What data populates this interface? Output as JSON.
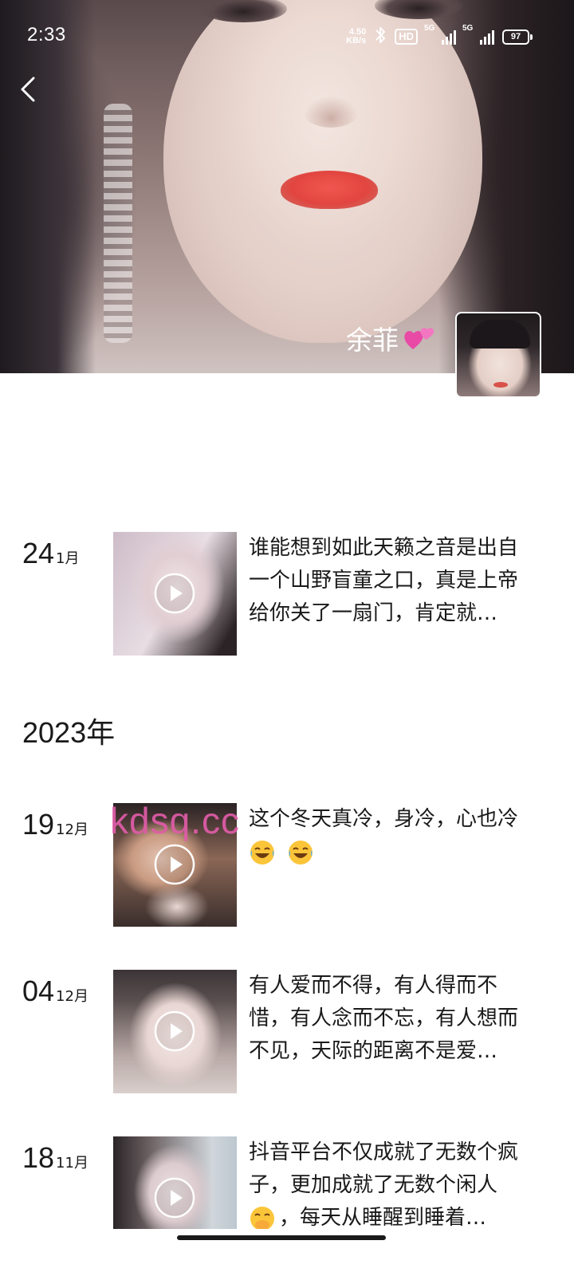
{
  "status_bar": {
    "time": "2:33",
    "net_speed_value": "4.50",
    "net_speed_unit": "KB/s",
    "hd_label": "HD",
    "signal_1_label": "5G",
    "signal_2_label": "5G",
    "battery": "97",
    "icons": [
      "bluetooth-icon",
      "hd-icon",
      "signal-icon",
      "signal-icon",
      "battery-icon"
    ]
  },
  "header": {
    "back_icon": "chevron-left-icon"
  },
  "profile": {
    "name": "余菲",
    "name_emoji": "two-hearts-icon"
  },
  "posts": [
    {
      "day": "24",
      "month": "1月",
      "lines": [
        "谁能想到如此天籁之音是出自",
        "一个山野盲童之口，真是上帝",
        "给你关了一扇门，肯定就…"
      ]
    },
    {
      "day": "19",
      "month": "12月",
      "lines": [
        "这个冬天真冷，身冷，心也冷"
      ],
      "emojis": [
        "laughing-tears-icon",
        "laughing-tears-icon"
      ]
    },
    {
      "day": "04",
      "month": "12月",
      "lines": [
        "有人爱而不得，有人得而不",
        "惜，有人念而不忘，有人想而",
        "不见，天际的距离不是爱…"
      ]
    },
    {
      "day": "18",
      "month": "11月",
      "lines": [
        "抖音平台不仅成就了无数个疯",
        "子，更加成就了无数个闲人",
        "，每天从睡醒到睡着…"
      ],
      "inline_emoji": "hand-over-mouth-icon"
    }
  ],
  "year_heading": "2023年",
  "watermark": "kdsq.cc",
  "colors": {
    "text": "#1a1a1a",
    "watermark": "#e05ca8",
    "background": "#ffffff"
  }
}
